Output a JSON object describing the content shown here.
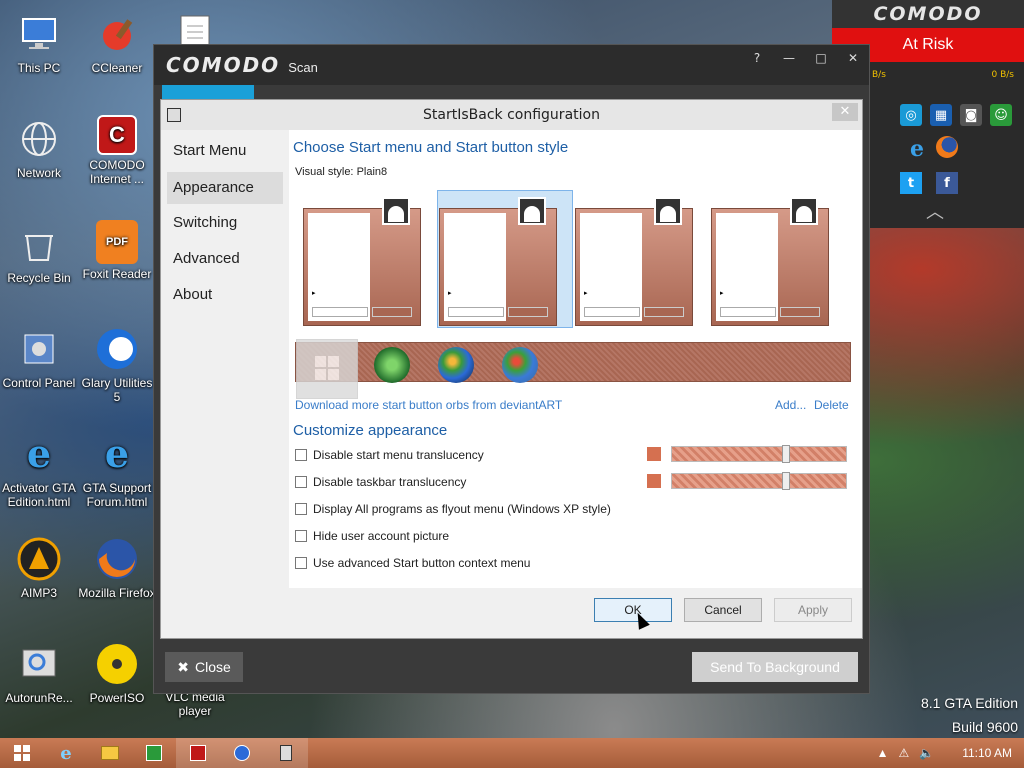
{
  "desktop": {
    "icons": [
      {
        "label": "This PC",
        "icon": "monitor-icon"
      },
      {
        "label": "CCleaner",
        "icon": "ccleaner-icon"
      },
      {
        "label": "Network",
        "icon": "network-icon"
      },
      {
        "label": "COMODO Internet ...",
        "icon": "comodo-icon"
      },
      {
        "label": "Recycle Bin",
        "icon": "recycle-bin-icon"
      },
      {
        "label": "Foxit Reader",
        "icon": "pdf-icon"
      },
      {
        "label": "Control Panel",
        "icon": "control-panel-icon"
      },
      {
        "label": "Glary Utilities 5",
        "icon": "glary-icon"
      },
      {
        "label": "Activator GTA Edition.html",
        "icon": "ie-icon"
      },
      {
        "label": "GTA Support Forum.html",
        "icon": "ie-icon"
      },
      {
        "label": "AIMP3",
        "icon": "aimp-icon"
      },
      {
        "label": "Mozilla Firefox",
        "icon": "firefox-icon"
      },
      {
        "label": "AutorunRe...",
        "icon": "autorun-icon"
      },
      {
        "label": "PowerISO",
        "icon": "poweriso-icon"
      },
      {
        "label": "VLC media player",
        "icon": "vlc-icon"
      }
    ],
    "watermark_line1": "8.1 GTA Edition",
    "watermark_line2": "Build 9600"
  },
  "comodo_panel": {
    "brand": "COMODO",
    "status": "At Risk",
    "speed_left": "B/s",
    "speed_right": "0 B/s",
    "status_color": "#e01010"
  },
  "comodo_window": {
    "title": "COMODO",
    "subtitle": "Scan",
    "controls": [
      "?",
      "—",
      "□",
      "✕"
    ],
    "close_label": "Close",
    "background_label": "Send To Background"
  },
  "dialog": {
    "title": "StartIsBack configuration",
    "nav": [
      "Start Menu",
      "Appearance",
      "Switching",
      "Advanced",
      "About"
    ],
    "active_nav": "Appearance",
    "heading": "Choose Start menu and Start button style",
    "visual_style_label": "Visual style:",
    "visual_style_value": "Plain8",
    "download_link": "Download more start button orbs from deviantART",
    "add_link": "Add...",
    "delete_link": "Delete",
    "customize_heading": "Customize appearance",
    "options": [
      {
        "label": "Disable start menu translucency",
        "checked": false
      },
      {
        "label": "Disable taskbar translucency",
        "checked": false
      },
      {
        "label": "Display All programs as flyout menu (Windows XP style)",
        "checked": false
      },
      {
        "label": "Hide user account picture",
        "checked": false
      },
      {
        "label": "Use advanced Start button context menu",
        "checked": false
      }
    ],
    "ok": "OK",
    "cancel": "Cancel",
    "apply": "Apply",
    "accent_color": "#1e5fa6"
  },
  "taskbar": {
    "time": "11:10 AM"
  }
}
